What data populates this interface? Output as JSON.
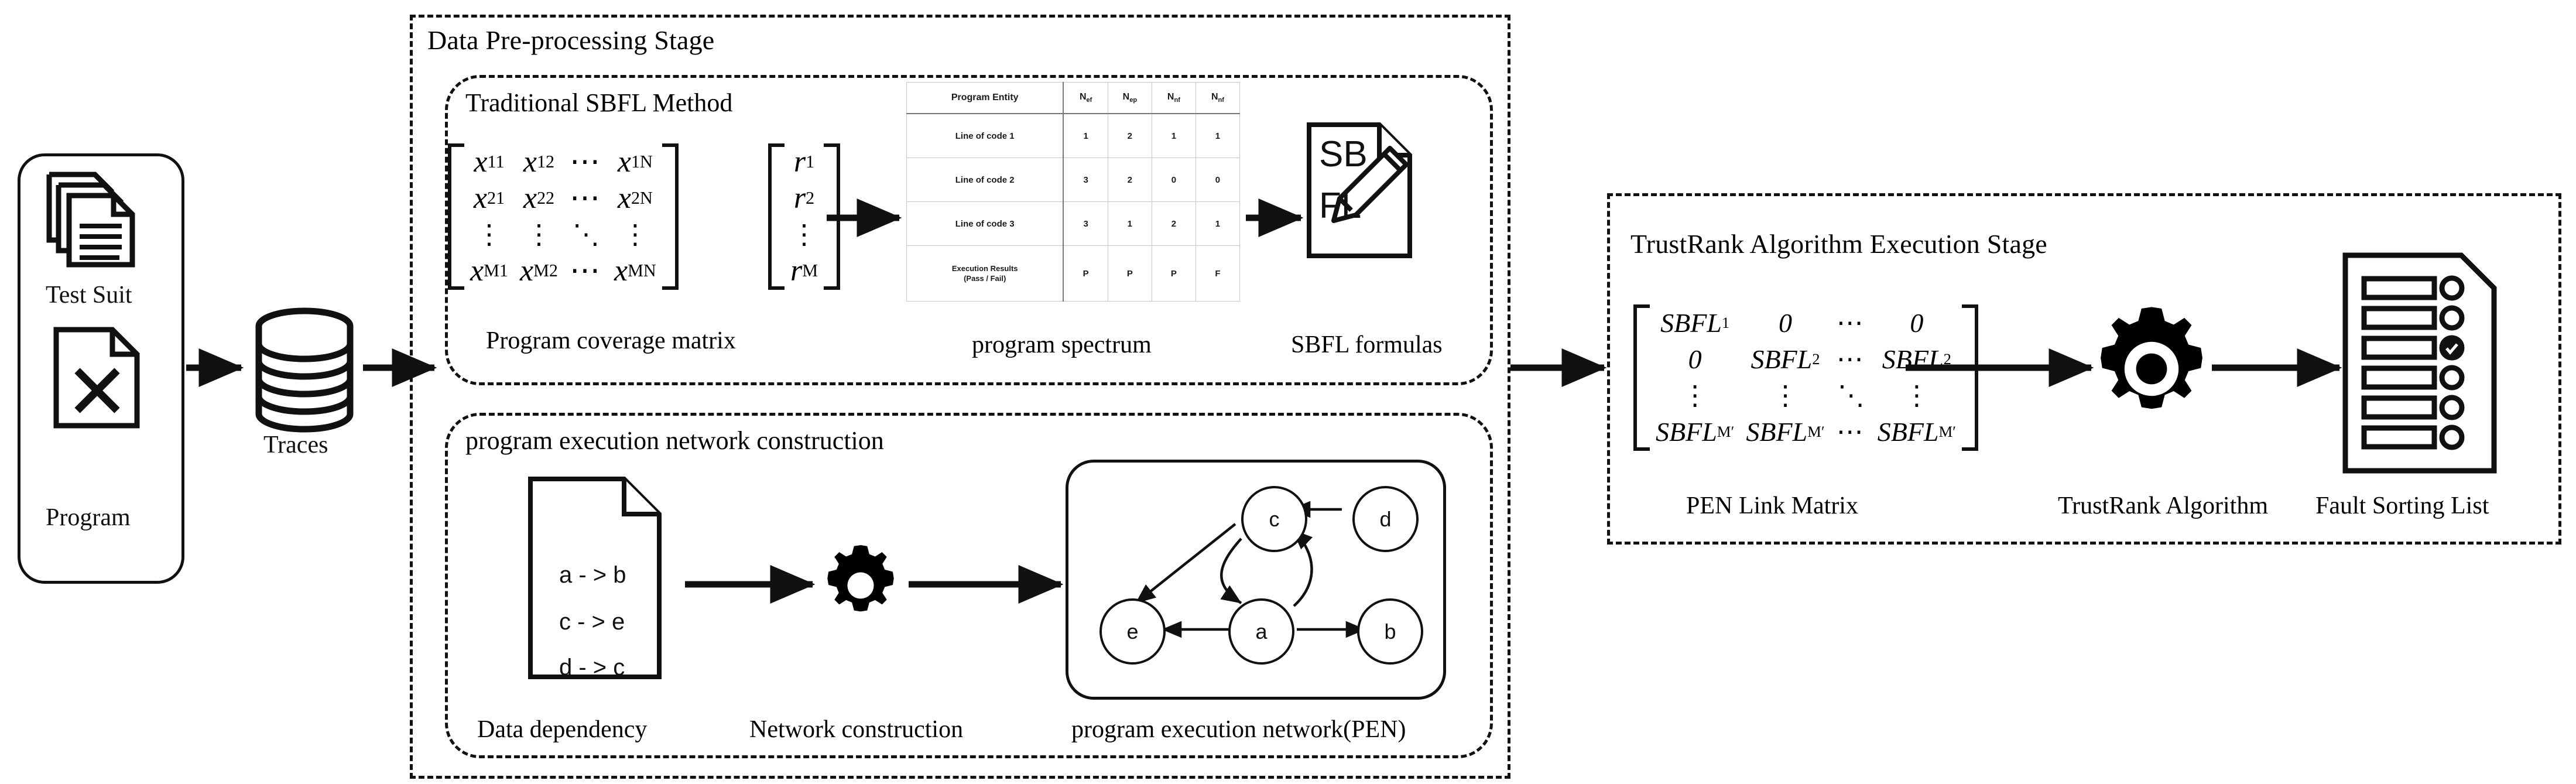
{
  "stages": {
    "preprocessing": {
      "title": "Data Pre-processing Stage"
    },
    "trustrank": {
      "title": "TrustRank Algorithm Execution Stage"
    },
    "sbfl_sub": {
      "title": "Traditional SBFL Method"
    },
    "pen_sub": {
      "title": "program execution network construction"
    }
  },
  "input": {
    "test_suit_label": "Test Suit",
    "program_label": "Program",
    "traces_label": "Traces"
  },
  "captions": {
    "coverage_matrix": "Program coverage matrix",
    "program_spectrum": "program spectrum",
    "sbfl_formulas": "SBFL formulas",
    "data_dependency": "Data dependency",
    "network_construction": "Network construction",
    "pen": "program execution network(PEN)",
    "pen_link_matrix": "PEN Link Matrix",
    "trustrank_algorithm": "TrustRank Algorithm",
    "fault_sorting_list": "Fault Sorting List"
  },
  "coverage_matrix": {
    "rows": [
      [
        "x",
        "11",
        "x",
        "12",
        "⋯",
        "x",
        "1N"
      ],
      [
        "x",
        "21",
        "x",
        "22",
        "⋯",
        "x",
        "2N"
      ],
      [
        "⋮",
        "",
        "⋮",
        "",
        "⋱",
        "⋮",
        ""
      ],
      [
        "x",
        "M1",
        "x",
        "M2",
        "⋯",
        "x",
        "MN"
      ]
    ],
    "cells": [
      [
        "x",
        "11"
      ],
      [
        "x",
        "12"
      ],
      [
        "⋯",
        ""
      ],
      [
        "x",
        "1N"
      ],
      [
        "x",
        "21"
      ],
      [
        "x",
        "22"
      ],
      [
        "⋯",
        ""
      ],
      [
        "x",
        "2N"
      ],
      [
        "⋮",
        ""
      ],
      [
        "⋮",
        ""
      ],
      [
        "⋱",
        ""
      ],
      [
        "⋮",
        ""
      ],
      [
        "x",
        "M1"
      ],
      [
        "x",
        "M2"
      ],
      [
        "⋯",
        ""
      ],
      [
        "x",
        "MN"
      ]
    ]
  },
  "result_vector": {
    "cells": [
      [
        "r",
        "1"
      ],
      [
        "r",
        "2"
      ],
      [
        "⋮",
        ""
      ],
      [
        "r",
        "M"
      ]
    ]
  },
  "pen_link_matrix": {
    "cells": [
      [
        "SBFL",
        "1"
      ],
      [
        "0",
        ""
      ],
      [
        "⋯",
        ""
      ],
      [
        "0",
        ""
      ],
      [
        "0",
        ""
      ],
      [
        "SBFL",
        "2"
      ],
      [
        "⋯",
        ""
      ],
      [
        "SBFL",
        "2"
      ],
      [
        "⋮",
        ""
      ],
      [
        "⋮",
        ""
      ],
      [
        "⋱",
        ""
      ],
      [
        "⋮",
        ""
      ],
      [
        "SBFL",
        "M′"
      ],
      [
        "SBFL",
        "M′"
      ],
      [
        "⋯",
        ""
      ],
      [
        "SBFL",
        "M′"
      ]
    ]
  },
  "spectrum_table": {
    "headers": [
      "Program Entity",
      "N",
      "N",
      "N",
      "N"
    ],
    "header_subs": [
      "",
      "ef",
      "ep",
      "nf",
      "nf"
    ],
    "rows": [
      {
        "label": "Line of code 1",
        "values": [
          "1",
          "2",
          "1",
          "1"
        ]
      },
      {
        "label": "Line of code 2",
        "values": [
          "3",
          "2",
          "0",
          "0"
        ]
      },
      {
        "label": "Line of code 3",
        "values": [
          "3",
          "1",
          "2",
          "1"
        ]
      },
      {
        "label_line1": "Execution Results",
        "label_line2": "(Pass / Fail)",
        "values": [
          "P",
          "P",
          "P",
          "F"
        ]
      }
    ]
  },
  "sbfl_doc": {
    "line1": "SB",
    "line2": "FL"
  },
  "dependency_doc": {
    "lines": [
      "a - > b",
      "c - > e",
      "d - > c"
    ]
  },
  "pen_graph": {
    "nodes": [
      {
        "id": "c",
        "label": "c"
      },
      {
        "id": "d",
        "label": "d"
      },
      {
        "id": "e",
        "label": "e"
      },
      {
        "id": "a",
        "label": "a"
      },
      {
        "id": "b",
        "label": "b"
      }
    ],
    "edges": [
      {
        "from": "d",
        "to": "c"
      },
      {
        "from": "c",
        "to": "e"
      },
      {
        "from": "c",
        "to": "a"
      },
      {
        "from": "a",
        "to": "c"
      },
      {
        "from": "a",
        "to": "e"
      },
      {
        "from": "a",
        "to": "b"
      }
    ]
  },
  "fault_list": {
    "rows": 6,
    "checked_index": 2
  },
  "colors": {
    "stroke": "#111111",
    "background": "#ffffff",
    "table_grid": "#c8c8c8"
  }
}
